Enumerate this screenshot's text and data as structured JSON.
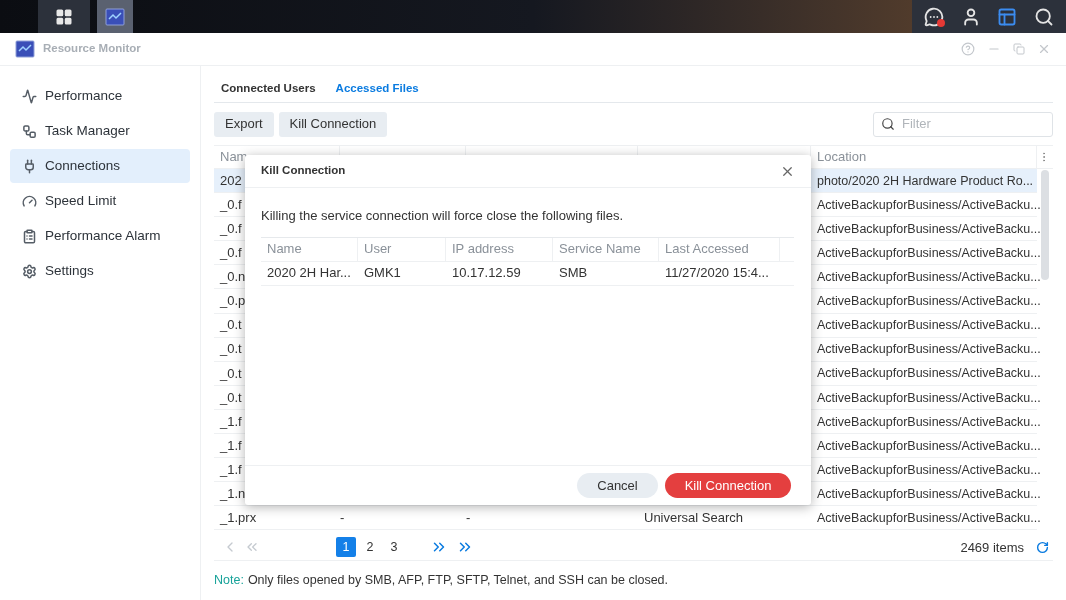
{
  "taskbar": {
    "apps": [
      {
        "selected": false
      },
      {
        "selected": true
      }
    ],
    "tray": [
      {
        "kind": "chat",
        "notification": true,
        "active": false
      },
      {
        "kind": "user",
        "notification": false,
        "active": false
      },
      {
        "kind": "widgets",
        "notification": false,
        "active": true
      },
      {
        "kind": "search",
        "notification": false,
        "active": false
      }
    ]
  },
  "window": {
    "title": "Resource Monitor"
  },
  "sidebar": {
    "items": [
      {
        "label": "Performance",
        "selected": false
      },
      {
        "label": "Task Manager",
        "selected": false
      },
      {
        "label": "Connections",
        "selected": true
      },
      {
        "label": "Speed Limit",
        "selected": false
      },
      {
        "label": "Performance Alarm",
        "selected": false
      },
      {
        "label": "Settings",
        "selected": false
      }
    ]
  },
  "tabs": [
    {
      "label": "Connected Users",
      "selected": false
    },
    {
      "label": "Accessed Files",
      "selected": true
    }
  ],
  "toolbar": {
    "buttons": [
      "Export",
      "Kill Connection"
    ],
    "filter": {
      "placeholder": "Filter"
    }
  },
  "table": {
    "columns": [
      "Nam",
      "Location"
    ],
    "rows": [
      {
        "name": "202",
        "location": "photo/2020 2H Hardware Product Ro...",
        "selected": true
      },
      {
        "name": "_0.f",
        "location": "ActiveBackupforBusiness/ActiveBacku...",
        "selected": false
      },
      {
        "name": "_0.f",
        "location": "ActiveBackupforBusiness/ActiveBacku...",
        "selected": false
      },
      {
        "name": "_0.f",
        "location": "ActiveBackupforBusiness/ActiveBacku...",
        "selected": false
      },
      {
        "name": "_0.n",
        "location": "ActiveBackupforBusiness/ActiveBacku...",
        "selected": false
      },
      {
        "name": "_0.p",
        "location": "ActiveBackupforBusiness/ActiveBacku...",
        "selected": false
      },
      {
        "name": "_0.t",
        "location": "ActiveBackupforBusiness/ActiveBacku...",
        "selected": false
      },
      {
        "name": "_0.t",
        "location": "ActiveBackupforBusiness/ActiveBacku...",
        "selected": false
      },
      {
        "name": "_0.t",
        "location": "ActiveBackupforBusiness/ActiveBacku...",
        "selected": false
      },
      {
        "name": "_0.t",
        "location": "ActiveBackupforBusiness/ActiveBacku...",
        "selected": false
      },
      {
        "name": "_1.f",
        "location": "ActiveBackupforBusiness/ActiveBacku...",
        "selected": false
      },
      {
        "name": "_1.f",
        "location": "ActiveBackupforBusiness/ActiveBacku...",
        "selected": false
      },
      {
        "name": "_1.f",
        "location": "ActiveBackupforBusiness/ActiveBacku...",
        "selected": false
      },
      {
        "name": "_1.n",
        "location": "ActiveBackupforBusiness/ActiveBacku...",
        "selected": false
      },
      {
        "name": "_1.prx",
        "user": "-",
        "ip": "-",
        "service": "Universal Search",
        "location": "ActiveBackupforBusiness/ActiveBacku...",
        "selected": false
      }
    ]
  },
  "pagination": {
    "first_disabled": true,
    "prev_disabled": true,
    "next_disabled": false,
    "last_disabled": false,
    "pages": [
      {
        "label": "1",
        "selected": true
      },
      {
        "label": "2",
        "selected": false
      },
      {
        "label": "3",
        "selected": false
      }
    ],
    "count": "2469 items"
  },
  "note": {
    "label": "Note:",
    "text": "Only files opened by SMB, AFP, FTP, SFTP, Telnet, and SSH can be closed."
  },
  "dialog": {
    "title": "Kill Connection",
    "message": "Killing the service connection will force close the following files.",
    "columns": [
      "Name",
      "User",
      "IP address",
      "Service Name",
      "Last Accessed"
    ],
    "rows": [
      [
        "2020 2H Har...",
        "GMK1",
        "10.17.12.59",
        "SMB",
        "11/27/2020 15:4..."
      ]
    ],
    "buttons": [
      {
        "label": "Cancel",
        "kind": "secondary"
      },
      {
        "label": "Kill Connection",
        "kind": "danger"
      }
    ]
  }
}
